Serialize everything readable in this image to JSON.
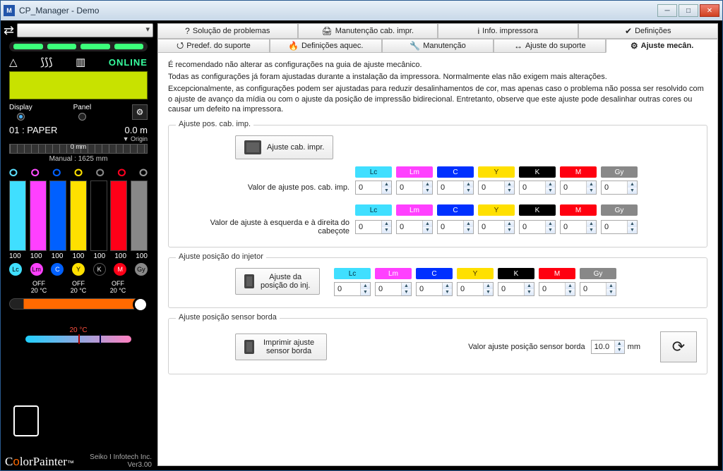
{
  "window": {
    "title": "CP_Manager - Demo"
  },
  "left": {
    "online": "ONLINE",
    "display_label": "Display",
    "panel_label": "Panel",
    "paper_line": "01 : PAPER",
    "paper_dist": "0.0  m",
    "origin": "▼ Origin",
    "ruler_center": "0   mm",
    "manual": "Manual : 1625   mm",
    "ink_levels": [
      "100",
      "100",
      "100",
      "100",
      "100",
      "100",
      "100"
    ],
    "chip_labels": [
      "Lc",
      "Lm",
      "C",
      "Y",
      "K",
      "M",
      "Gy"
    ],
    "heater_off": "OFF",
    "heater_temp": "20 °C",
    "temp_red": "20 °C",
    "brand": "ColorPainter",
    "company": "Seiko I Infotech Inc.",
    "version": "Ver3.00"
  },
  "tabs_top": [
    {
      "icon": "?",
      "label": "Solução de problemas"
    },
    {
      "icon": "🖨",
      "label": "Manutenção cab. impr."
    },
    {
      "icon": "i",
      "label": "Info. impressora"
    },
    {
      "icon": "✔",
      "label": "Definições"
    }
  ],
  "tabs_sub": [
    {
      "icon": "⭯",
      "label": "Predef. do suporte"
    },
    {
      "icon": "🔥",
      "label": "Definições aquec."
    },
    {
      "icon": "🔧",
      "label": "Manutenção"
    },
    {
      "icon": "↔",
      "label": "Ajuste do suporte"
    },
    {
      "icon": "⚙",
      "label": "Ajuste mecân."
    }
  ],
  "intro": [
    "É recomendado não alterar as configurações na guia de ajuste mecânico.",
    "Todas as configurações já foram ajustadas durante a instalação da impressora. Normalmente elas não exigem mais alterações.",
    "Excepcionalmente, as configurações podem ser ajustadas para reduzir desalinhamentos de cor, mas apenas caso o problema não possa ser resolvido com o ajuste de avanço da mídia ou com o ajuste da posição de impressão bidirecional. Entretanto, observe que este ajuste pode desalinhar outras cores ou causar um defeito na impressora."
  ],
  "groups": {
    "headpos": {
      "title": "Ajuste pos. cab. imp.",
      "button": "Ajuste cab. impr.",
      "row1_label": "Valor de ajuste pos. cab. imp.",
      "row2_label": "Valor de ajuste à esquerda e à direita do cabeçote",
      "colors": [
        "Lc",
        "Lm",
        "C",
        "Y",
        "K",
        "M",
        "Gy"
      ],
      "row1_values": [
        "0",
        "0",
        "0",
        "0",
        "0",
        "0",
        "0"
      ],
      "row2_values": [
        "0",
        "0",
        "0",
        "0",
        "0",
        "0",
        "0"
      ]
    },
    "injector": {
      "title": "Ajuste posição do injetor",
      "button": "Ajuste da posição do inj.",
      "colors": [
        "Lc",
        "Lm",
        "C",
        "Y",
        "K",
        "M",
        "Gy"
      ],
      "values": [
        "0",
        "0",
        "0",
        "0",
        "0",
        "0",
        "0"
      ]
    },
    "sensor": {
      "title": "Ajuste posição sensor borda",
      "button": "Imprimir ajuste sensor borda",
      "value_label": "Valor ajuste posição sensor borda",
      "value": "10.0",
      "unit": "mm"
    }
  }
}
